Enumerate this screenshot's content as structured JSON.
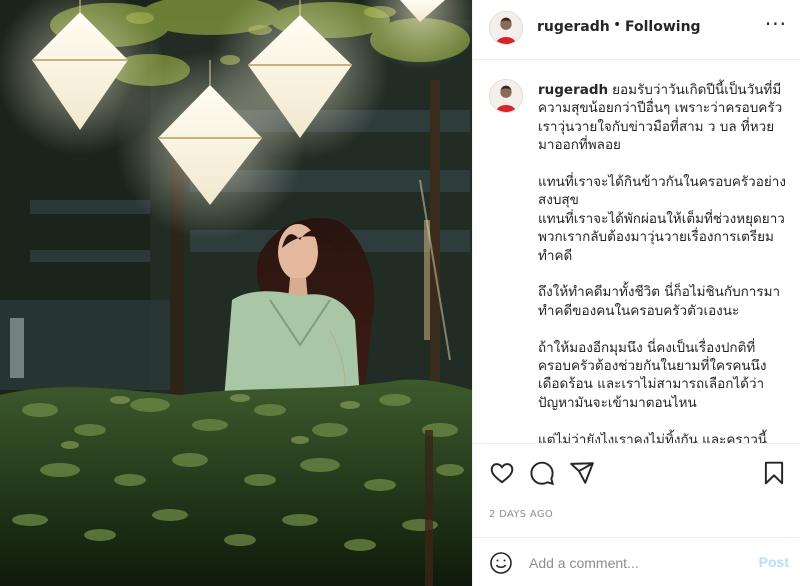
{
  "header": {
    "username": "rugeradh",
    "separator": "•",
    "follow_status": "Following",
    "more": "···"
  },
  "caption": {
    "username": "rugeradh",
    "paragraphs": [
      "ยอมรับว่าวันเกิดปีนี้เป็นวันที่มีความสุขน้อยกว่าปีอื่นๆ เพราะว่าครอบครัวเราวุ่นวายใจกับข่าวมือที่สาม ว บล ที่หวยมาออกที่พลอย",
      "แทนที่เราจะได้กินข้าวกันในครอบครัวอย่างสงบสุข\nแทนที่เราจะได้พักผ่อนให้เต็มที่ช่วงหยุดยาว พวกเรากลับต้องมาวุ่นวายเรื่องการเตรียมทำคดี",
      "ถึงให้ทำคดีมาทั้งชีวิต นี่ก็อไม่ชินกับการมาทำคดีของคนในครอบครัวตัวเองนะ",
      "ถ้าให้มองอีกมุมนึง นี่คงเป็นเรื่องปกติที่ครอบครัวต้องช่วยกันในยามที่ใครคนนึงเดือดร้อน และเราไม่สามารถเลือกได้ว่าปัญหามันจะเข้ามาตอนไหน",
      "แต่ไม่ว่ายังไงเราคงไม่ทิ้งกัน และคราวนี้ต้องจัดการให้เด็ดขาด"
    ]
  },
  "actions": {
    "like_icon": "heart-icon",
    "comment_icon": "comment-icon",
    "share_icon": "paper-plane-icon",
    "save_icon": "bookmark-icon"
  },
  "timestamp": "2 DAYS AGO",
  "comment_bar": {
    "emoji_icon": "emoji-icon",
    "placeholder": "Add a comment...",
    "post_label": "Post"
  },
  "colors": {
    "text": "#262626",
    "muted": "#8e8e8e",
    "border": "#efefef",
    "post_disabled": "#b2dffc"
  }
}
